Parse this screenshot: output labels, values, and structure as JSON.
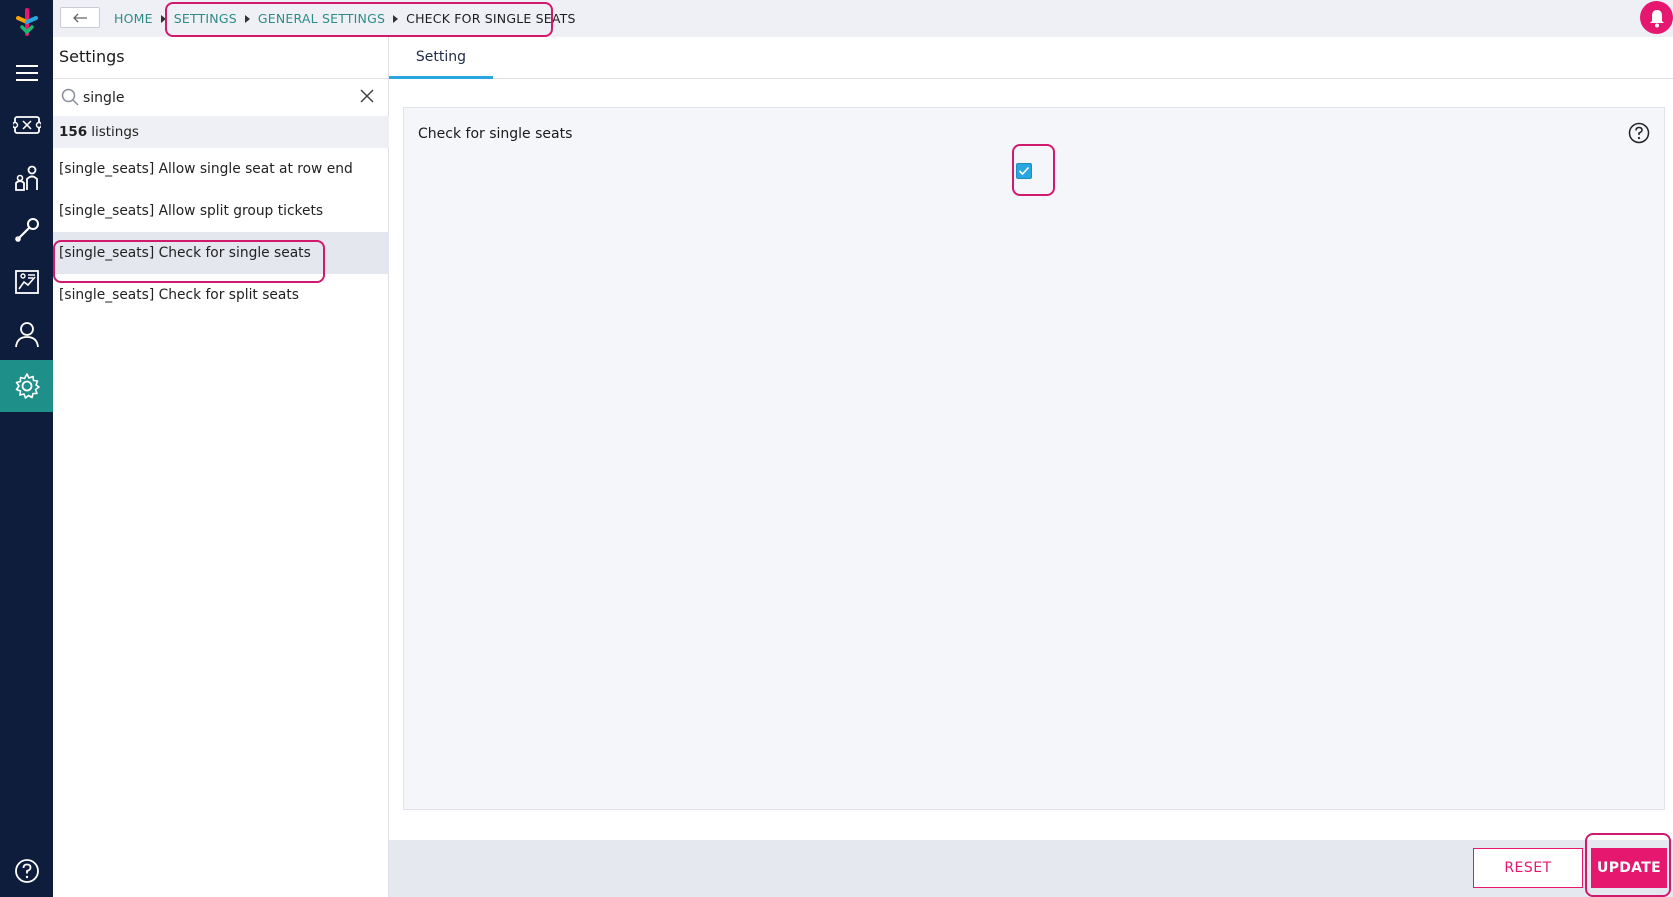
{
  "breadcrumb": {
    "items": [
      "HOME",
      "SETTINGS",
      "GENERAL SETTINGS"
    ],
    "current": "CHECK FOR SINGLE SEATS"
  },
  "sidebar": {
    "icons": [
      "menu-icon",
      "tickets-icon",
      "customers-icon",
      "tools-icon",
      "reports-icon",
      "user-icon",
      "settings-icon",
      "help-icon"
    ],
    "active": "settings-icon"
  },
  "settings_panel": {
    "title": "Settings",
    "search": {
      "value": "single",
      "placeholder": ""
    },
    "count": "156",
    "count_label": "listings",
    "items": [
      "[single_seats] Allow single seat at row end",
      "[single_seats] Allow split group tickets",
      "[single_seats] Check for single seats",
      "[single_seats] Check for split seats"
    ],
    "selected_index": 2
  },
  "main": {
    "tab": "Setting",
    "setting_label": "Check for single seats",
    "checked": true
  },
  "footer": {
    "reset_label": "RESET",
    "update_label": "UPDATE"
  },
  "colors": {
    "rail": "#0f1d3d",
    "accent_teal": "#1f8f8a",
    "accent_pink": "#e6176f",
    "checkbox_blue": "#2aa6e0"
  }
}
